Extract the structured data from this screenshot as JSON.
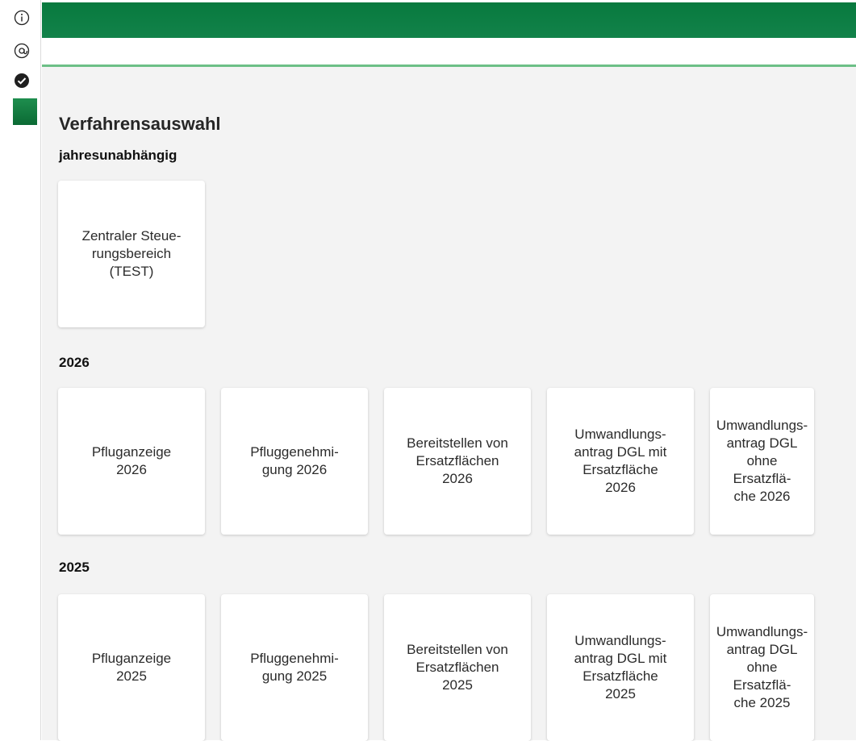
{
  "sidebar": {
    "icons": [
      "info-icon",
      "at-sign-icon",
      "check-circle-icon"
    ],
    "accent_color": "#0b6a34"
  },
  "header": {
    "bar_color": "#087a3e",
    "divider_color": "#6cbf86"
  },
  "main": {
    "page_title": "Verfahrensauswahl",
    "sections": [
      {
        "title": "jahresunabhängig",
        "cards": [
          "Zentraler Steue-\nrungsbereich\n(TEST)"
        ]
      },
      {
        "title": "2026",
        "cards": [
          "Pfluganzeige\n2026",
          "Pfluggenehmi-\ngung 2026",
          "Bereitstellen von\nErsatzflächen\n2026",
          "Umwandlungs-\nantrag DGL mit\nErsatzfläche\n2026",
          "Umwandlungs-\nantrag DGL\nohne Ersatzflä-\nche 2026"
        ]
      },
      {
        "title": "2025",
        "cards": [
          "Pfluganzeige\n2025",
          "Pfluggenehmi-\ngung 2025",
          "Bereitstellen von\nErsatzflächen\n2025",
          "Umwandlungs-\nantrag DGL mit\nErsatzfläche\n2025",
          "Umwandlungs-\nantrag DGL\nohne Ersatzflä-\nche 2025"
        ]
      }
    ]
  }
}
